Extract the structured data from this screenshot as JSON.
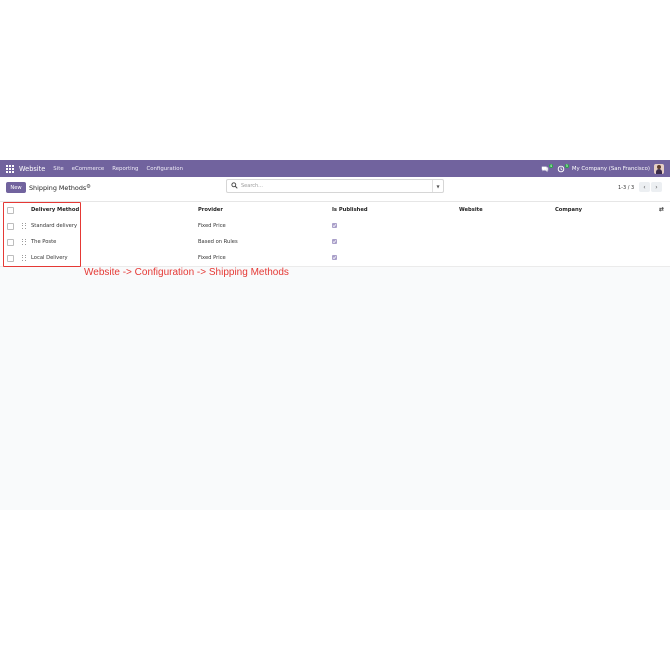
{
  "navbar": {
    "brand": "Website",
    "menu": [
      "Site",
      "eCommerce",
      "Reporting",
      "Configuration"
    ],
    "messages_count": "4",
    "activities_count": "5",
    "company": "My Company (San Francisco)"
  },
  "controls": {
    "new_label": "New",
    "title": "Shipping Methods",
    "search_placeholder": "Search...",
    "pager": "1-3 / 3"
  },
  "table": {
    "columns": [
      "Delivery Method",
      "Provider",
      "Is Published",
      "Website",
      "Company"
    ],
    "rows": [
      {
        "method": "Standard delivery",
        "provider": "Fixed Price",
        "published": true
      },
      {
        "method": "The Poste",
        "provider": "Based on Rules",
        "published": true
      },
      {
        "method": "Local Delivery",
        "provider": "Fixed Price",
        "published": true
      }
    ]
  },
  "annotation": "Website -> Configuration -> Shipping Methods",
  "colors": {
    "brand": "#71639e",
    "annotation": "#e53935",
    "published_check": "#a99fc9"
  }
}
